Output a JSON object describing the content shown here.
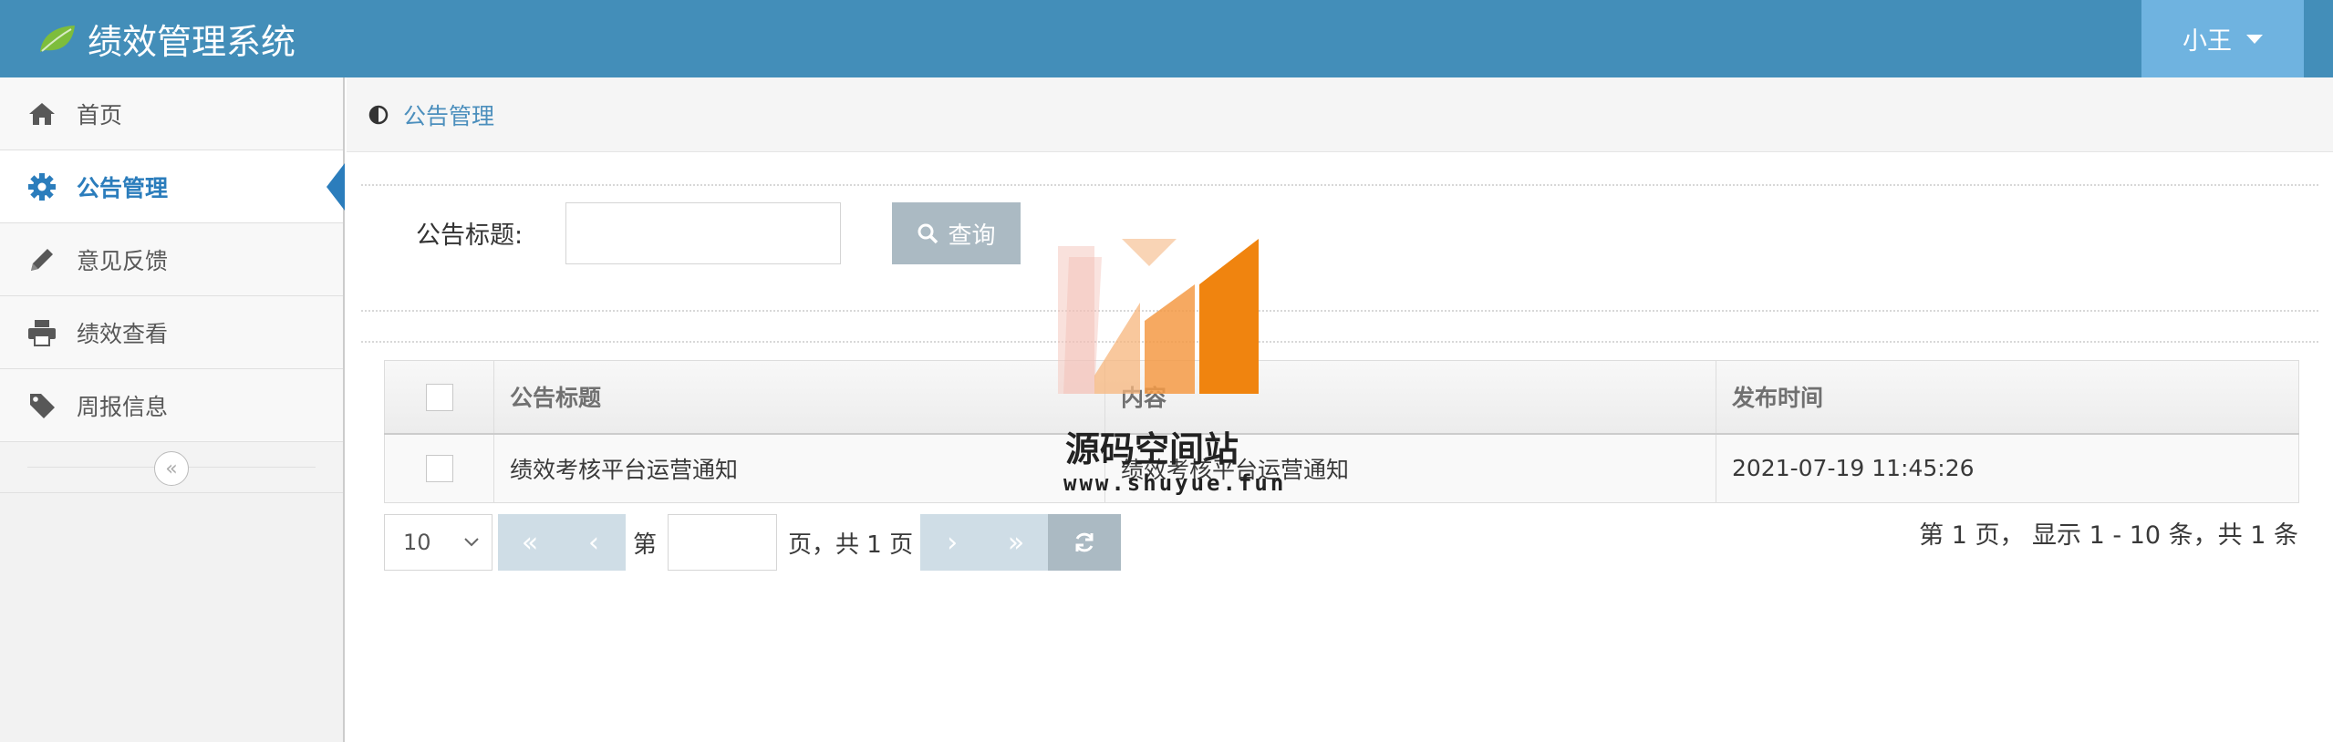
{
  "app": {
    "title": "绩效管理系统",
    "user": "小王"
  },
  "sidebar": {
    "items": [
      {
        "label": "首页",
        "icon": "home-icon",
        "active": false
      },
      {
        "label": "公告管理",
        "icon": "gear-icon",
        "active": true
      },
      {
        "label": "意见反馈",
        "icon": "pencil-icon",
        "active": false
      },
      {
        "label": "绩效查看",
        "icon": "print-icon",
        "active": false
      },
      {
        "label": "周报信息",
        "icon": "tag-icon",
        "active": false
      }
    ]
  },
  "breadcrumb": {
    "label": "公告管理"
  },
  "search": {
    "label": "公告标题:",
    "value": "",
    "button_label": "查询"
  },
  "table": {
    "columns": [
      "公告标题",
      "内容",
      "发布时间"
    ],
    "rows": [
      {
        "title": "绩效考核平台运营通知",
        "content": "绩效考核平台运营通知",
        "time": "2021-07-19 11:45:26"
      }
    ]
  },
  "pager": {
    "page_size": "10",
    "prefix": "第",
    "page_value": "",
    "suffix": "页，共 1 页",
    "info": "第 1 页，  显示 1 - 10 条，共 1 条"
  },
  "watermark": {
    "name": "源码空间站",
    "url": "www.shuyue.fun"
  },
  "colors": {
    "header": "#438eb9",
    "accent": "#2b7dbc",
    "button": "#abbac3"
  }
}
